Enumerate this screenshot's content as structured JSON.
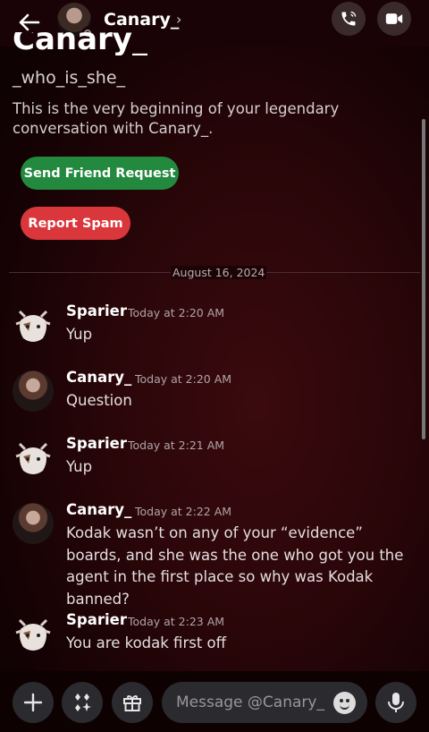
{
  "header": {
    "name": "Canary_",
    "chevron": "›"
  },
  "profile": {
    "name": "Canary_",
    "handle": "_who_is_she_",
    "intro": "This is the very beginning of your legendary conversation with Canary_.",
    "friend_button": "Send Friend Request",
    "spam_button": "Report Spam"
  },
  "divider": {
    "date": "August 16, 2024"
  },
  "messages": [
    {
      "author": "Sparier",
      "time": "Today at 2:20 AM",
      "text": "Yup"
    },
    {
      "author": "Canary_",
      "time": "Today at 2:20 AM",
      "text": "Question"
    },
    {
      "author": "Sparier",
      "time": "Today at 2:21 AM",
      "text": "Yup"
    },
    {
      "author": "Canary_",
      "time": "Today at 2:22 AM",
      "text": "Kodak wasn’t on any of your “evidence” boards, and she was the one who got you the agent in the first place so why was Kodak banned?"
    },
    {
      "author": "Sparier",
      "time": "Today at 2:23 AM",
      "text": "You are kodak first off"
    }
  ],
  "composer": {
    "placeholder": "Message @Canary_"
  },
  "colors": {
    "friend": "#23893f",
    "spam": "#da373c",
    "background": "#2a0609"
  },
  "icons": [
    "back-arrow-icon",
    "phone-icon",
    "video-icon",
    "plus-icon",
    "apps-icon",
    "gift-icon",
    "emoji-icon",
    "mic-icon"
  ]
}
